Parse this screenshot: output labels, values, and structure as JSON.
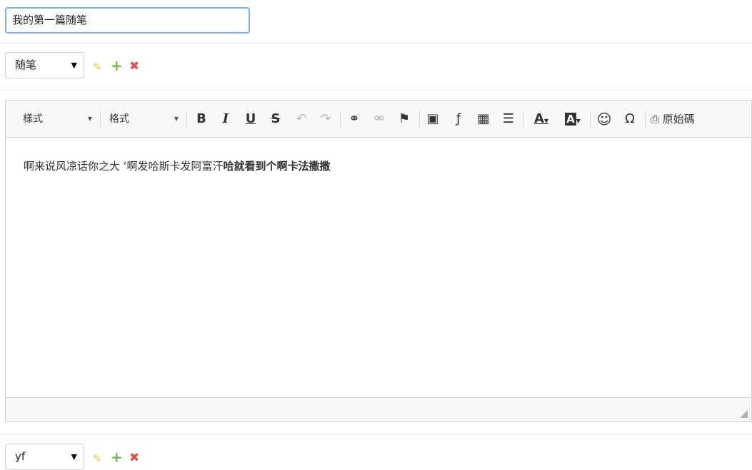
{
  "title_input": {
    "value": "我的第一篇随笔"
  },
  "category": {
    "selected": "随笔",
    "arrow": "▼",
    "edit_icon": "✎",
    "add_icon": "+",
    "delete_icon": "✖"
  },
  "toolbar": {
    "styles_label": "樣式",
    "format_label": "格式",
    "bold": "B",
    "italic": "I",
    "underline": "U",
    "strike": "S",
    "undo": "↶",
    "redo": "↷",
    "link": "⚭",
    "unlink": "⚮",
    "anchor": "⚑",
    "image": "▣",
    "flash": "ƒ",
    "table": "▦",
    "hr": "☰",
    "text_color": "A",
    "bg_color": "A",
    "smiley": "☺",
    "special_char": "Ω",
    "source_icon": "⎙",
    "source_label": "原始碼"
  },
  "content": {
    "normal_text": "啊来说风凉话你之大 ‘啊发哈斯卡发阿富汗",
    "bold_text": "哈就看到个啊卡法撒撒"
  },
  "tag": {
    "selected": "yf",
    "arrow": "▼",
    "edit_icon": "✎",
    "add_icon": "+",
    "delete_icon": "✖"
  },
  "colors": {
    "accent_border": "#7faee6",
    "edit": "#e8c44a",
    "add": "#6dbb4a",
    "delete": "#d9534f"
  }
}
